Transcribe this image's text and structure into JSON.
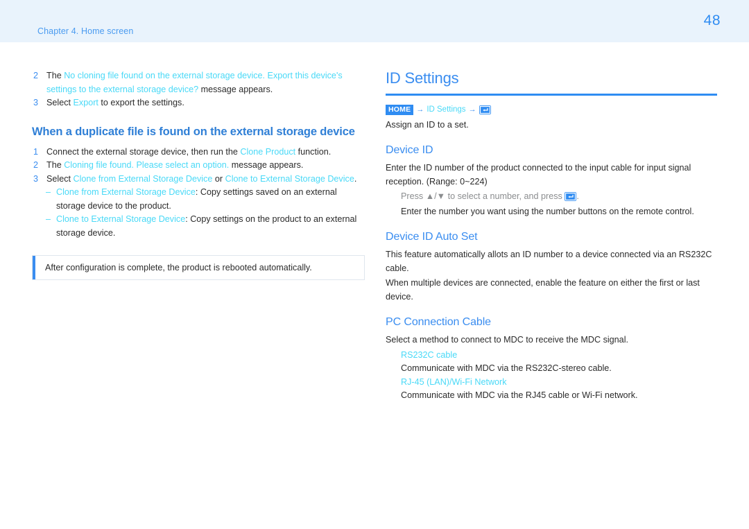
{
  "header": {
    "chapter": "Chapter 4. Home screen",
    "page_number": "48",
    "band_color": "#e9f3fc",
    "accent_color": "#2f8cf2",
    "highlight_color": "#49d9f7"
  },
  "left_column": {
    "steps_top": [
      {
        "marker": "2",
        "segments": [
          {
            "text": "The ",
            "style": "dark"
          },
          {
            "text": "No cloning file found on the external storage device. Export this device's settings to the external storage device?",
            "style": "cyan"
          },
          {
            "text": "  message appears.",
            "style": "dark"
          }
        ]
      },
      {
        "marker": "3",
        "segments": [
          {
            "text": "Select ",
            "style": "dark"
          },
          {
            "text": "Export",
            "style": "cyan"
          },
          {
            "text": " to export the settings.",
            "style": "dark"
          }
        ]
      }
    ],
    "heading": "When a duplicate file is found on the external storage device",
    "steps_bottom": [
      {
        "marker": "1",
        "segments": [
          {
            "text": "Connect the external storage device, then run the ",
            "style": "dark"
          },
          {
            "text": "Clone Product",
            "style": "cyan"
          },
          {
            "text": " function.",
            "style": "dark"
          }
        ]
      },
      {
        "marker": "2",
        "segments": [
          {
            "text": "The ",
            "style": "dark"
          },
          {
            "text": "Cloning file found. Please select an option.",
            "style": "cyan"
          },
          {
            "text": " message appears.",
            "style": "dark"
          }
        ]
      },
      {
        "marker": "3",
        "segments": [
          {
            "text": "Select ",
            "style": "dark"
          },
          {
            "text": "Clone from External Storage Device",
            "style": "cyan"
          },
          {
            "text": " or ",
            "style": "dark"
          },
          {
            "text": "Clone to External Storage Device",
            "style": "cyan"
          },
          {
            "text": ".",
            "style": "dark"
          }
        ]
      }
    ],
    "sub_items": [
      {
        "dash": "–",
        "segments": [
          {
            "text": "Clone from External Storage Device",
            "style": "cyan"
          },
          {
            "text": ": Copy settings saved on an external storage device to the product.",
            "style": "dark"
          }
        ]
      },
      {
        "dash": "–",
        "segments": [
          {
            "text": "Clone to External Storage Device",
            "style": "cyan"
          },
          {
            "text": ": Copy settings on the product to an external storage device.",
            "style": "dark"
          }
        ]
      }
    ],
    "note": "After configuration is complete, the product is rebooted automatically."
  },
  "right_column": {
    "title": "ID Settings",
    "breadcrumb": {
      "home_label": "HOME",
      "arrow": "→",
      "link_label": "ID Settings",
      "enter_icon": "enter-key-icon"
    },
    "intro": "Assign an ID to a set.",
    "sections": [
      {
        "heading": "Device ID",
        "paragraphs": [
          {
            "text": "Enter the ID number of the product connected to the input cable for input signal reception. (Range: 0~224)",
            "style": "normal"
          },
          {
            "text": "Press ▲/▼ to select a number, and press ",
            "style": "muted-indent-enter",
            "tail": "."
          },
          {
            "text": "Enter the number you want using the number buttons on the remote control.",
            "style": "indent"
          }
        ]
      },
      {
        "heading": "Device ID Auto Set",
        "paragraphs": [
          {
            "text": "This feature automatically allots an ID number to a device connected via an RS232C cable.",
            "style": "normal"
          },
          {
            "text": "When multiple devices are connected, enable the feature on either the first or last device.",
            "style": "normal"
          }
        ]
      },
      {
        "heading": "PC Connection Cable",
        "paragraphs": [
          {
            "text": "Select a method to connect to MDC to receive the MDC signal.",
            "style": "normal"
          }
        ],
        "options": [
          {
            "label": "RS232C cable",
            "desc": "Communicate with MDC via the RS232C-stereo cable."
          },
          {
            "label": "RJ-45 (LAN)/Wi-Fi Network",
            "desc": "Communicate with MDC via the RJ45 cable or Wi-Fi network."
          }
        ]
      }
    ]
  }
}
